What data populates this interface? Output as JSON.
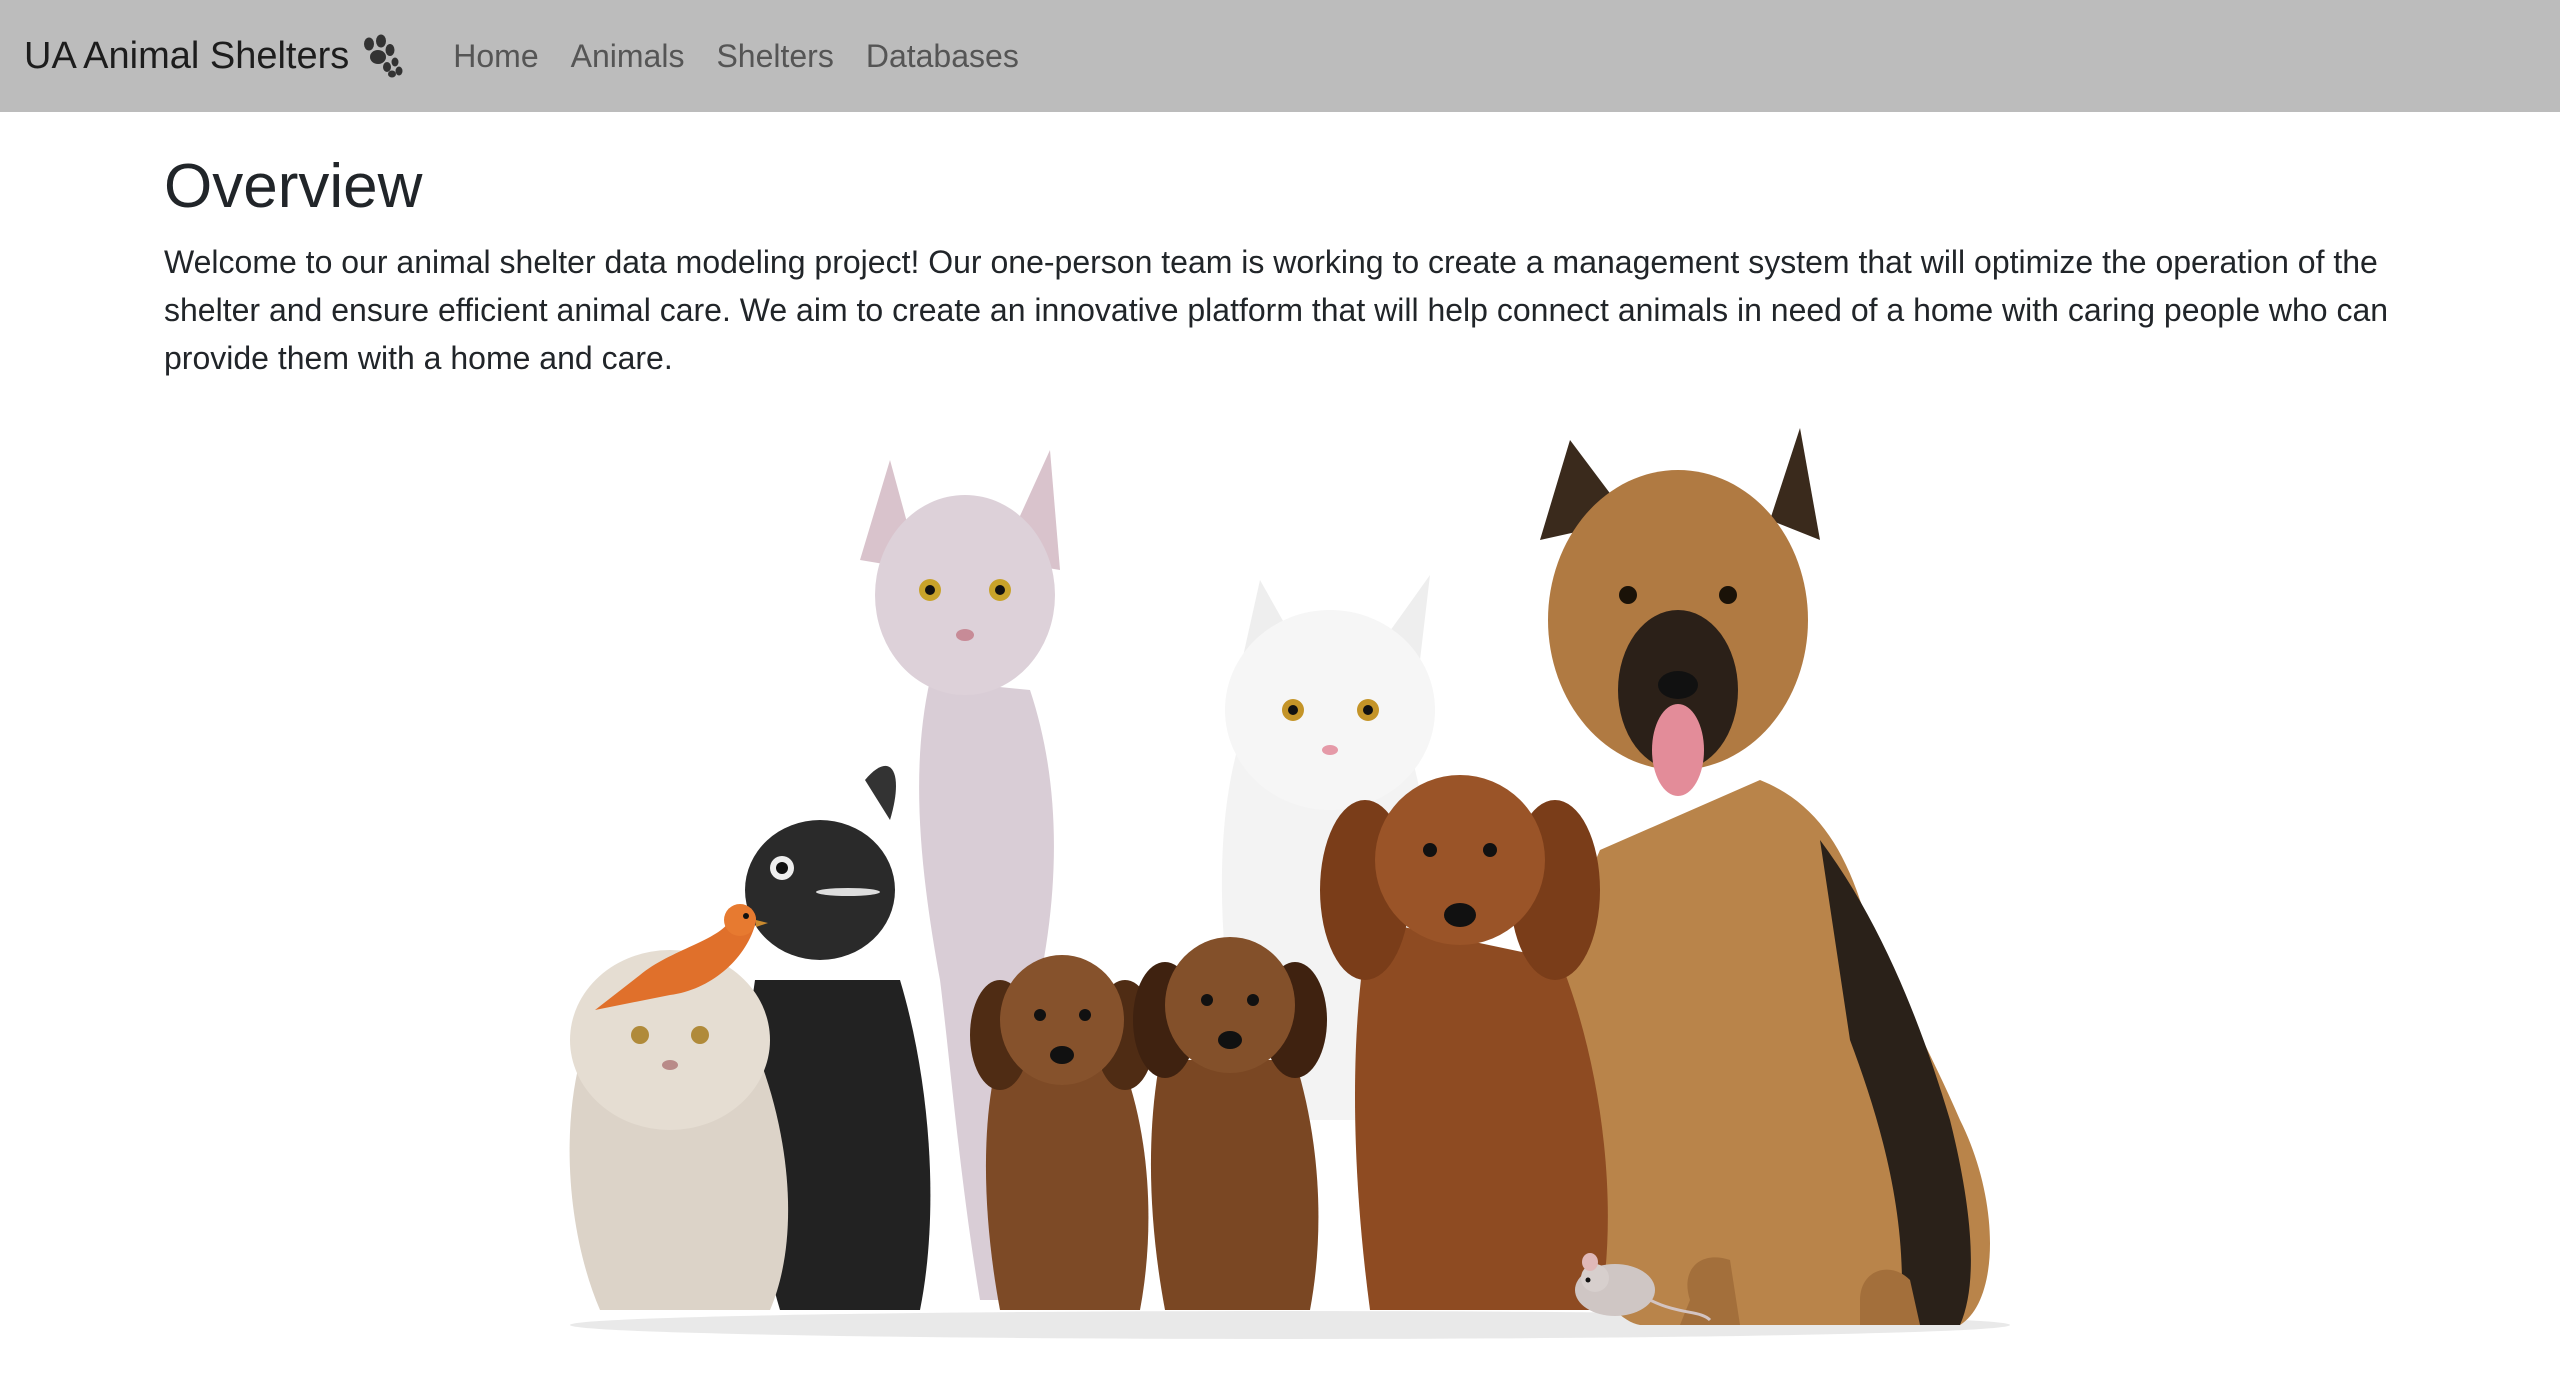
{
  "navbar": {
    "brand": "UA Animal Shelters",
    "brand_icon": "paw-icon",
    "links": [
      {
        "label": "Home"
      },
      {
        "label": "Animals"
      },
      {
        "label": "Shelters"
      },
      {
        "label": "Databases"
      }
    ]
  },
  "main": {
    "title": "Overview",
    "intro": "Welcome to our animal shelter data modeling project! Our one-person team is working to create a management system that will optimize the operation of the shelter and ensure efficient animal care. We aim to create an innovative platform that will help connect animals in need of a home with caring people who can provide them with a home and care."
  },
  "hero_image": {
    "subject": "group-of-pets-photo"
  },
  "colors": {
    "navbar_bg": "#bcbcbc",
    "nav_link": "#555555",
    "text": "#212529"
  }
}
